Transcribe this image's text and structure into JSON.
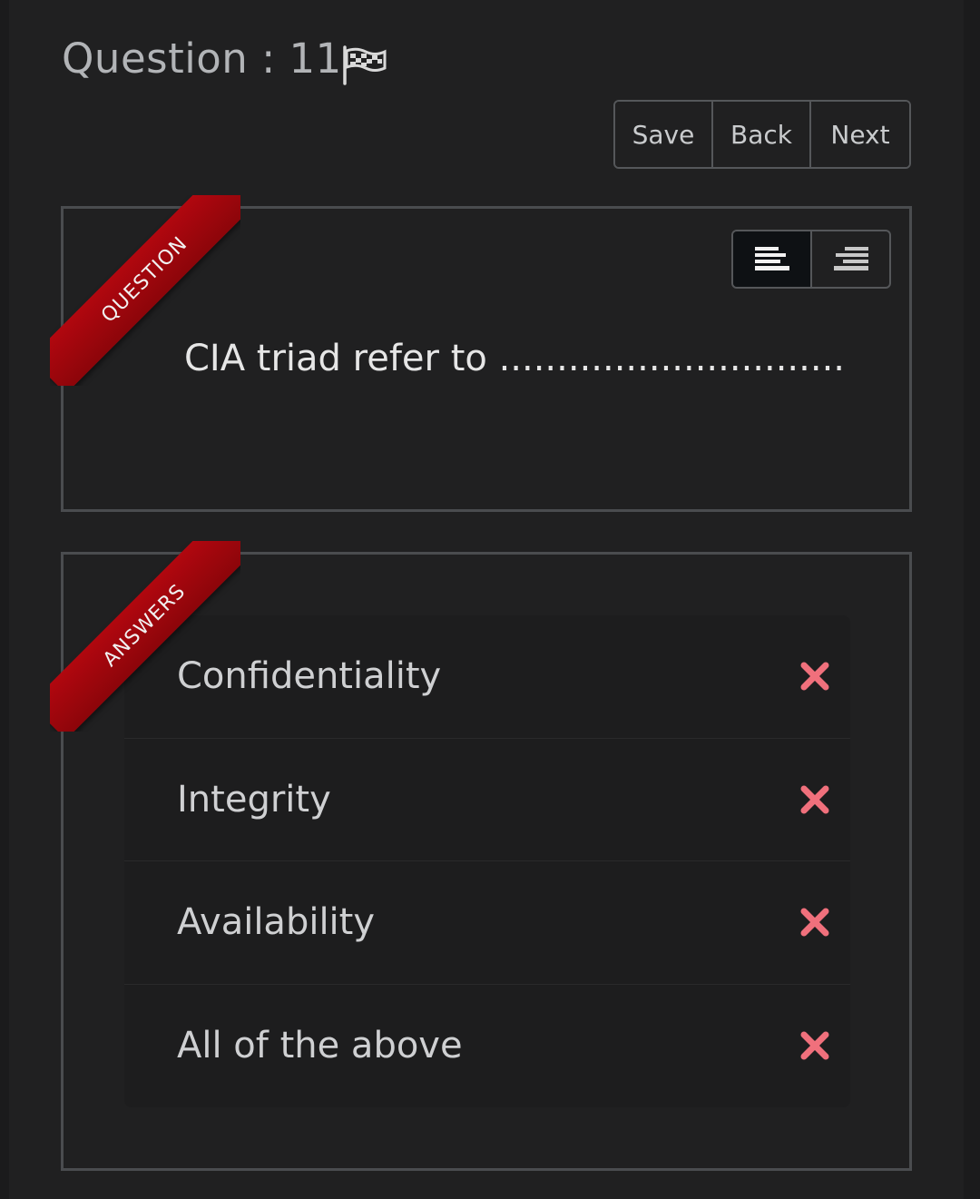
{
  "header": {
    "question_title": "Question : 11"
  },
  "nav": {
    "save_label": "Save",
    "back_label": "Back",
    "next_label": "Next"
  },
  "question_section": {
    "ribbon_label": "QUESTION",
    "text": "CIA triad refer to ..............................",
    "align_options": [
      "align-left-icon",
      "align-right-icon"
    ],
    "align_selected": "align-left-icon"
  },
  "answers_section": {
    "ribbon_label": "ANSWERS",
    "options": [
      {
        "label": "Confidentiality",
        "status": "incorrect"
      },
      {
        "label": "Integrity",
        "status": "incorrect"
      },
      {
        "label": "Availability",
        "status": "incorrect"
      },
      {
        "label": "All of the above",
        "status": "incorrect"
      }
    ]
  },
  "colors": {
    "ribbon": "#a0060d",
    "incorrect_mark": "#f0707c",
    "background": "#202021"
  }
}
